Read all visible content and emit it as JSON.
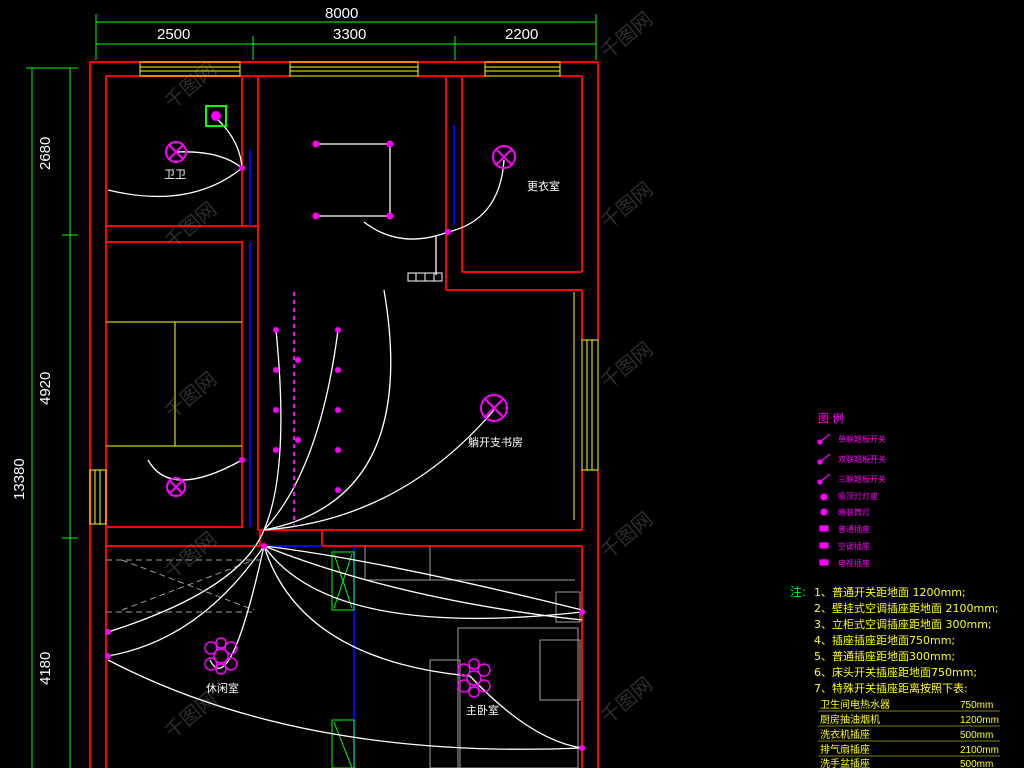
{
  "dimensions": {
    "total_width": "8000",
    "segments": [
      "2500",
      "3300",
      "2200"
    ],
    "total_height": "13380",
    "left_segments": [
      "2680",
      "4920",
      "4180"
    ]
  },
  "rooms": {
    "bathroom": "卫卫",
    "cloakroom": "更衣室",
    "study": "躺开支书房",
    "living_room": "休闲室",
    "master_bedroom": "主卧室"
  },
  "legend": {
    "title": "图 例",
    "items": [
      {
        "icon": "single-switch-icon",
        "label": "单联翘板开关"
      },
      {
        "icon": "double-switch-icon",
        "label": "双联翘板开关"
      },
      {
        "icon": "triple-switch-icon",
        "label": "三联翘板开关"
      },
      {
        "icon": "ceiling-lamp-icon",
        "label": "吸顶灯灯座"
      },
      {
        "icon": "downlight-icon",
        "label": "暗装筒灯"
      },
      {
        "icon": "socket-icon",
        "label": "普通插座"
      },
      {
        "icon": "air-conditioner-socket-icon",
        "label": "空调插座"
      },
      {
        "icon": "tv-socket-icon",
        "label": "电视插座"
      }
    ]
  },
  "notes": {
    "heading": "注:",
    "items": [
      "1、普通开关距地面 1200mm;",
      "2、壁挂式空调插座距地面 2100mm;",
      "3、立柜式空调插座距地面 300mm;",
      "4、插座插座距地面750mm;",
      "5、普通插座距地面300mm;",
      "6、床头开关插座距地面750mm;",
      "7、特殊开关插座距离按照下表:"
    ]
  },
  "table": {
    "rows": [
      {
        "label": "卫生间电热水器",
        "value": "750mm"
      },
      {
        "label": "厨房抽油烟机",
        "value": "1200mm"
      },
      {
        "label": "洗衣机插座",
        "value": "500mm"
      },
      {
        "label": "排气扇插座",
        "value": "2100mm"
      },
      {
        "label": "洗手盆插座",
        "value": "500mm"
      }
    ]
  },
  "watermark": "千图网",
  "colors": {
    "wall": "#ff0000",
    "dimension": "#00ff00",
    "fixture": "#ff00ff",
    "wire": "#ffffff",
    "window": "#ffff00",
    "door": "#0000ff"
  }
}
